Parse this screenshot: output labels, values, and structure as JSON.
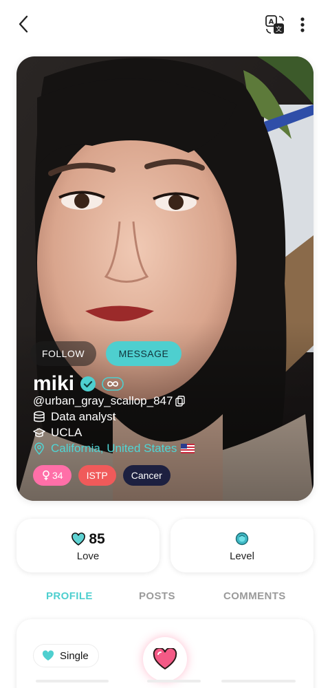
{
  "header": {
    "back_icon": "chevron-left-icon",
    "translate_icon": "translate-icon",
    "more_icon": "more-vertical-icon"
  },
  "profile": {
    "follow_label": "FOLLOW",
    "message_label": "MESSAGE",
    "name": "miki",
    "username": "@urban_gray_scallop_847",
    "occupation": "Data analyst",
    "school": "UCLA",
    "location": "California, United States",
    "tags": {
      "gender_age": "34",
      "mbti": "ISTP",
      "zodiac": "Cancer"
    }
  },
  "stats": {
    "love_value": "85",
    "love_label": "Love",
    "level_label": "Level"
  },
  "tabs": [
    "PROFILE",
    "POSTS",
    "COMMENTS"
  ],
  "active_tab": "PROFILE",
  "profile_section": {
    "relationship": "Single"
  },
  "colors": {
    "accent": "#4ecfcf",
    "gender_tag": "#ff6fa8",
    "mbti_tag": "#f05a5a",
    "zodiac_tag": "#1d2040",
    "heart": "#f45a86"
  }
}
